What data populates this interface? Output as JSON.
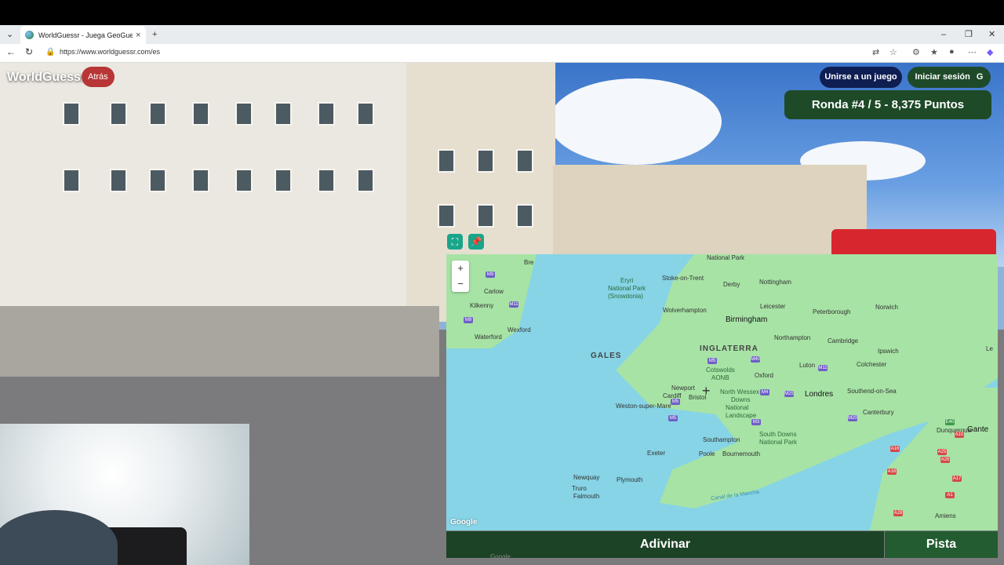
{
  "browser": {
    "tab_title": "WorldGuessr - Juega GeoGuessr",
    "tab_close": "×",
    "new_tab": "+",
    "url": "https://www.worldguessr.com/es"
  },
  "game": {
    "logo": "WorldGuessr",
    "back_label": "Atrás",
    "join_label": "Unirse a un juego",
    "login_label": "Iniciar sesión",
    "login_icon": "G",
    "round_info": "Ronda #4 / 5 - 8,375 Puntos",
    "guess_label": "Adivinar",
    "hint_label": "Pista"
  },
  "map": {
    "zoom_in": "+",
    "zoom_out": "−",
    "attribution": "Google",
    "labels": {
      "national_park": "National Park",
      "bre": "Bre",
      "stoke": "Stoke-on-Trent",
      "derby": "Derby",
      "nottingham": "Nottingham",
      "eryri": "Eryri",
      "eryri_np": "National Park",
      "snowdonia": "(Snowdonia)",
      "wolverhampton": "Wolverhampton",
      "birmingham": "Birmingham",
      "leicester": "Leicester",
      "peterborough": "Peterborough",
      "norwich": "Norwich",
      "carlow": "Carlow",
      "kilkenny": "Kilkenny",
      "wexford": "Wexford",
      "waterford": "Waterford",
      "northampton": "Northampton",
      "cambridge": "Cambridge",
      "gales": "GALES",
      "inglaterra": "INGLATERRA",
      "ipswich": "Ipswich",
      "cotswolds": "Cotswolds",
      "aonb": "AONB",
      "oxford": "Oxford",
      "luton": "Luton",
      "colchester": "Colchester",
      "newport": "Newport",
      "cardiff": "Cardiff",
      "bristol": "Bristol",
      "north_wessex": "North Wessex",
      "downs": "Downs",
      "national_landscape": "National",
      "landscape": "Landscape",
      "londres": "Londres",
      "southend": "Southend-on-Sea",
      "weston": "Weston-super-Mare",
      "canterbury": "Canterbury",
      "southampton": "Southampton",
      "south_downs": "South Downs",
      "south_downs_np": "National Park",
      "dunquerque": "Dunquerque",
      "gante": "Gante",
      "exeter": "Exeter",
      "poole": "Poole",
      "bournemouth": "Bournemouth",
      "newquay": "Newquay",
      "plymouth": "Plymouth",
      "truro": "Truro",
      "falmouth": "Falmouth",
      "canal": "Canal de la Mancha",
      "amiens": "Amiens",
      "le": "Le"
    },
    "shields": [
      "M9",
      "M11",
      "M9",
      "M5",
      "M40",
      "M11",
      "M4",
      "M25",
      "M20",
      "M5",
      "M3",
      "M5",
      "A16",
      "A25",
      "A26",
      "A16",
      "A1",
      "A28",
      "E40",
      "A10",
      "A17"
    ]
  },
  "footer_text": "Google",
  "colors": {
    "accent_green": "#1e4a27",
    "back_red": "#b83636",
    "join_navy": "#0f1e52",
    "map_water": "#86d4e6",
    "map_land": "#a7e3a5"
  }
}
